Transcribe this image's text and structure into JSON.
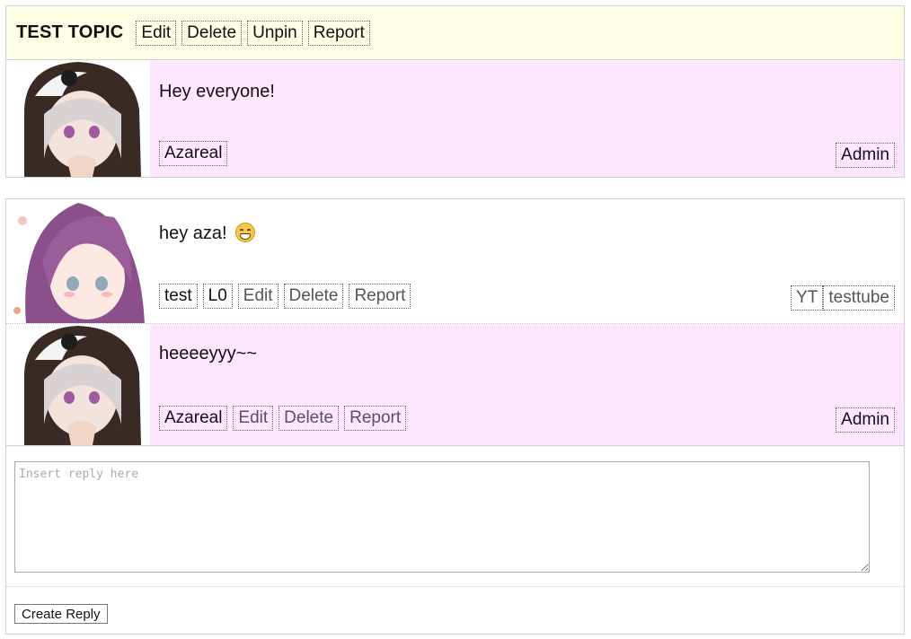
{
  "topic": {
    "title": "TEST TOPIC",
    "actions": [
      "Edit",
      "Delete",
      "Unpin",
      "Report"
    ]
  },
  "opening_post": {
    "text": "Hey everyone!",
    "author": "Azareal",
    "rank": "Admin",
    "avatar": "panda-hood-girl-avatar"
  },
  "replies": [
    {
      "text": "hey aza!",
      "emoji": "grinning-face",
      "author": "test",
      "level": "L0",
      "actions": [
        "Edit",
        "Delete",
        "Report"
      ],
      "right_tags": [
        "YT",
        "testtube"
      ],
      "avatar": "purple-hair-girl-avatar"
    },
    {
      "text": "heeeeyyy~~",
      "author": "Azareal",
      "actions": [
        "Edit",
        "Delete",
        "Report"
      ],
      "rank": "Admin",
      "avatar": "panda-hood-girl-avatar"
    }
  ],
  "reply_form": {
    "placeholder": "Insert reply here",
    "value": "",
    "submit_label": "Create Reply"
  },
  "colors": {
    "topic_header_bg": "#fefee5",
    "admin_post_bg": "#fee6fe",
    "border": "#cfcfcf"
  }
}
